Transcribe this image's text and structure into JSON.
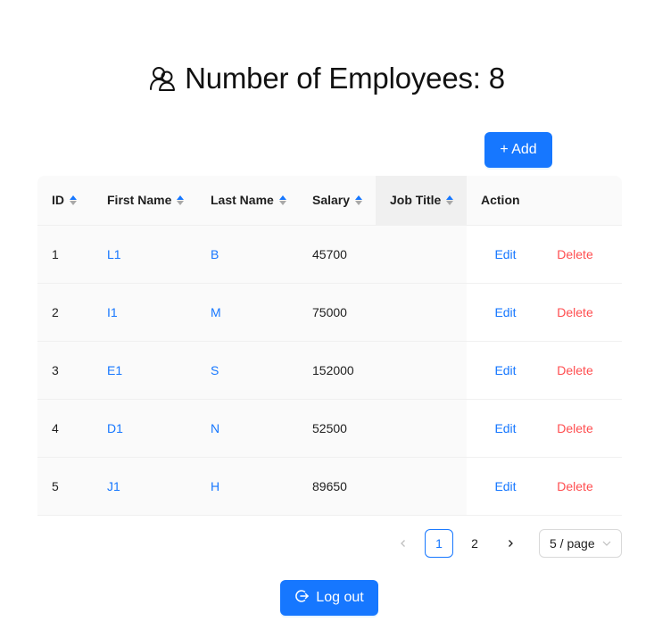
{
  "header": {
    "title": "Number of Employees: 8",
    "icon": "team-icon"
  },
  "toolbar": {
    "add_label": "+ Add"
  },
  "table": {
    "columns": [
      {
        "label": "ID",
        "sortable": true
      },
      {
        "label": "First Name",
        "sortable": true
      },
      {
        "label": "Last Name",
        "sortable": true
      },
      {
        "label": "Salary",
        "sortable": true
      },
      {
        "label": "Job Title",
        "sortable": true
      },
      {
        "label": "Action",
        "sortable": false
      }
    ],
    "rows": [
      {
        "id": "1",
        "first_name": "L1",
        "last_name": "B",
        "salary": "45700",
        "job_title": "",
        "edit": "Edit",
        "delete": "Delete"
      },
      {
        "id": "2",
        "first_name": "I1",
        "last_name": "M",
        "salary": "75000",
        "job_title": "",
        "edit": "Edit",
        "delete": "Delete"
      },
      {
        "id": "3",
        "first_name": "E1",
        "last_name": "S",
        "salary": "152000",
        "job_title": "",
        "edit": "Edit",
        "delete": "Delete"
      },
      {
        "id": "4",
        "first_name": "D1",
        "last_name": "N",
        "salary": "52500",
        "job_title": "",
        "edit": "Edit",
        "delete": "Delete"
      },
      {
        "id": "5",
        "first_name": "J1",
        "last_name": "H",
        "salary": "89650",
        "job_title": "",
        "edit": "Edit",
        "delete": "Delete"
      }
    ]
  },
  "pagination": {
    "pages": [
      "1",
      "2"
    ],
    "current": "1",
    "page_size": "5 / page"
  },
  "footer": {
    "logout_label": "Log out",
    "logout_icon": "logout-icon"
  },
  "colors": {
    "primary": "#1677ff",
    "danger": "#ff4d4f",
    "header_bg": "#fafafa",
    "sorted_header_bg": "#f0f0f0"
  }
}
